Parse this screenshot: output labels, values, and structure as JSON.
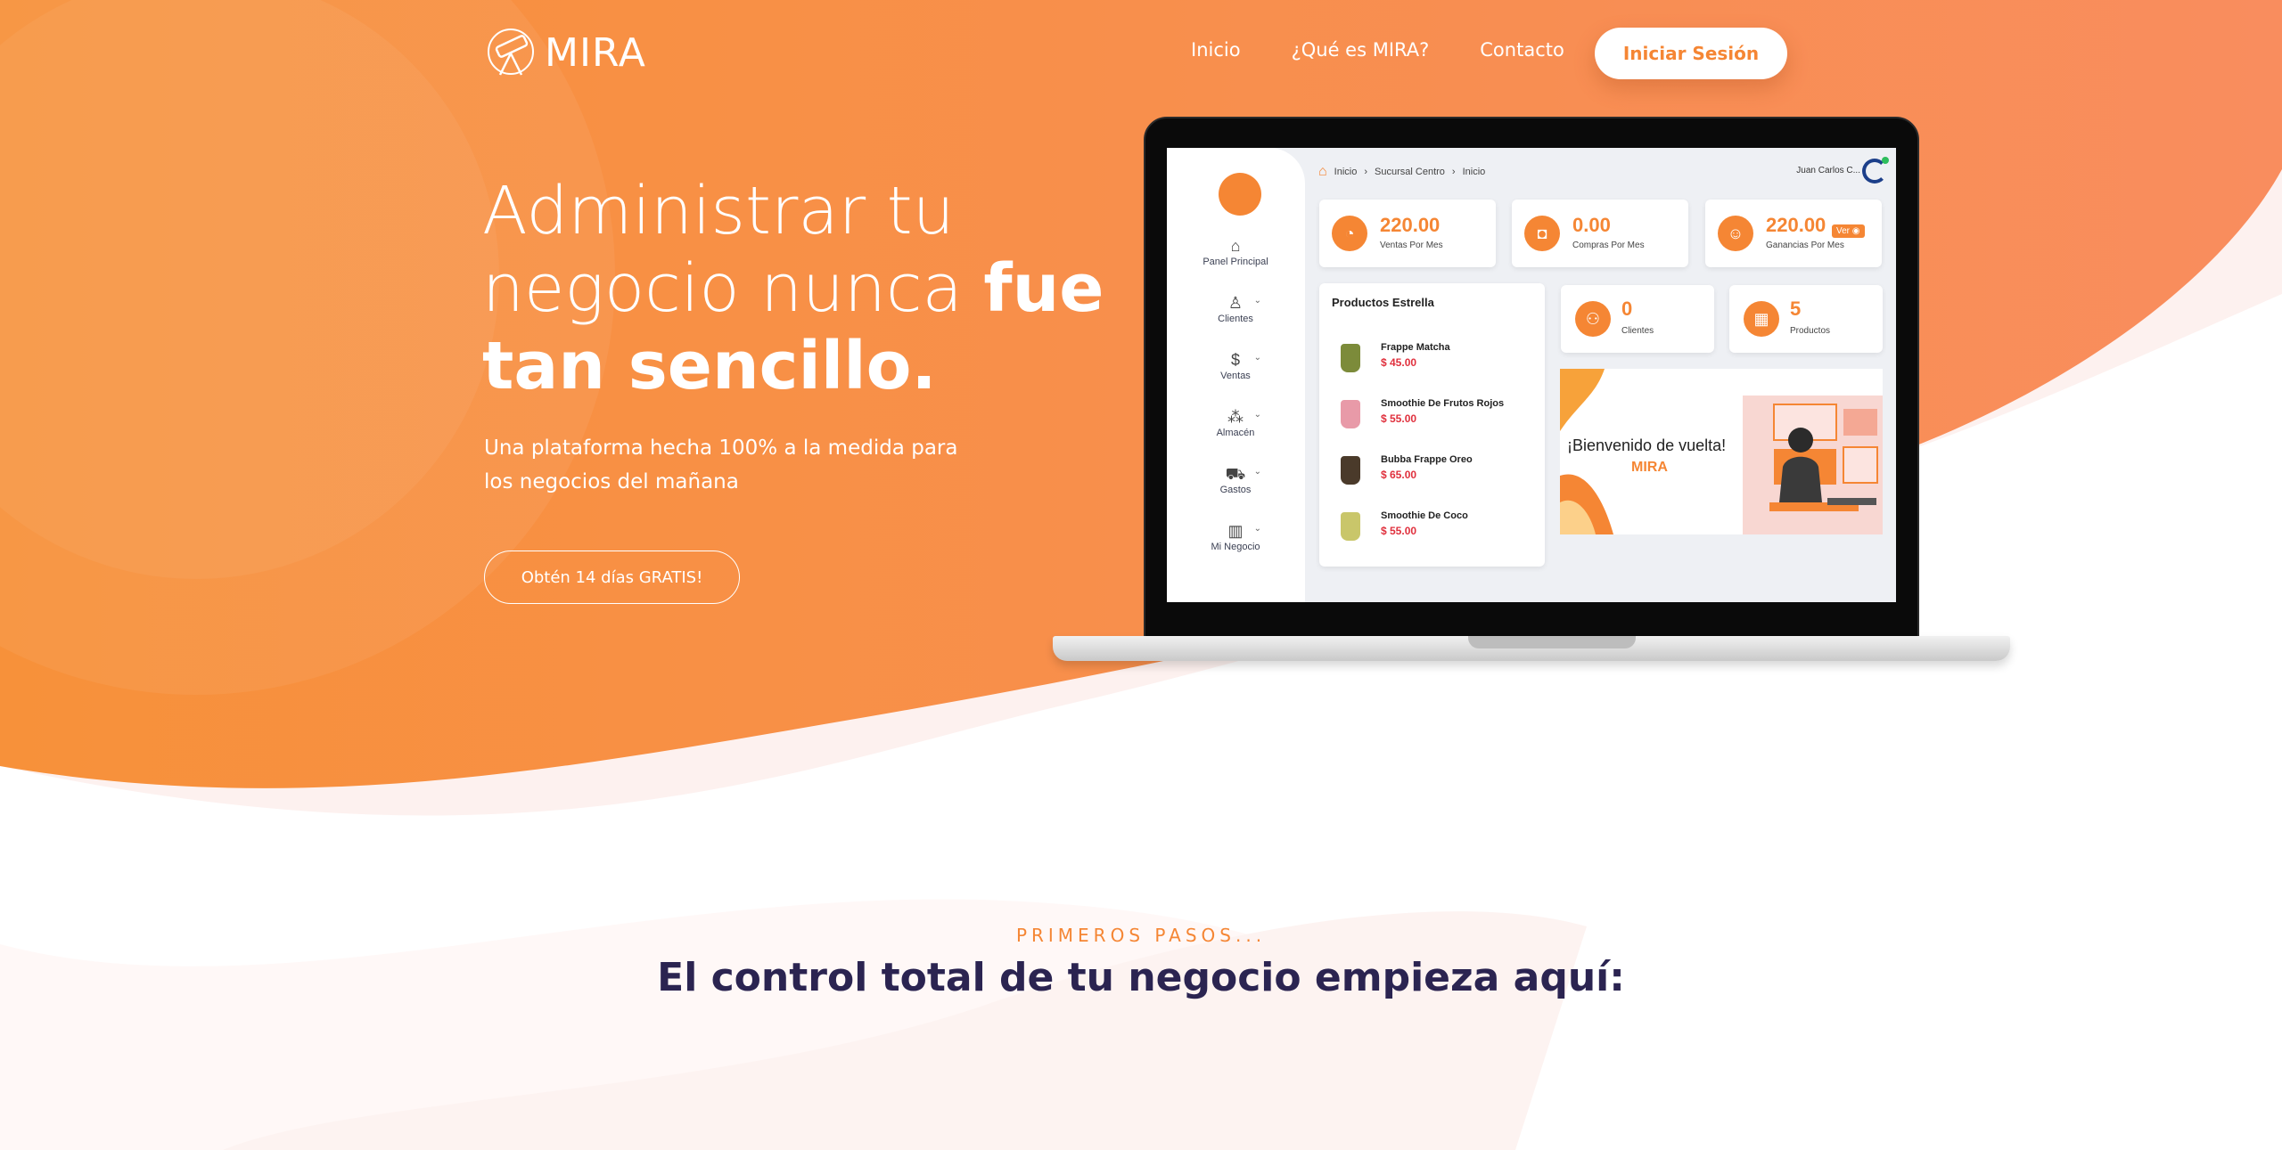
{
  "brand": {
    "name": "MIRA"
  },
  "nav": {
    "items": [
      "Inicio",
      "¿Qué es MIRA?",
      "Contacto"
    ],
    "login_label": "Iniciar Sesión"
  },
  "hero": {
    "title_light": "Administrar tu negocio nunca ",
    "title_bold": "fue tan sencillo.",
    "subtitle": "Una plataforma hecha 100% a la medida para los negocios del mañana",
    "cta_label": "Obtén 14 días GRATIS!"
  },
  "app": {
    "breadcrumb": [
      "Inicio",
      "Sucursal Centro",
      "Inicio"
    ],
    "user_name": "Juan Carlos C...",
    "sidebar": [
      {
        "label": "Panel Principal",
        "icon": "home-icon"
      },
      {
        "label": "Clientes",
        "icon": "user-add-icon"
      },
      {
        "label": "Ventas",
        "icon": "dollar-icon"
      },
      {
        "label": "Almacén",
        "icon": "boxes-icon"
      },
      {
        "label": "Gastos",
        "icon": "cart-icon"
      },
      {
        "label": "Mi Negocio",
        "icon": "chart-icon"
      }
    ],
    "stats": [
      {
        "value": "220.00",
        "label": "Ventas Por Mes"
      },
      {
        "value": "0.00",
        "label": "Compras Por Mes"
      },
      {
        "value": "220.00",
        "label": "Ganancias Por Mes"
      }
    ],
    "ver_label": "Ver",
    "counts": [
      {
        "value": "0",
        "label": "Clientes"
      },
      {
        "value": "5",
        "label": "Productos"
      }
    ],
    "products_title": "Productos Estrella",
    "products": [
      {
        "name": "Frappe Matcha",
        "price": "$ 45.00",
        "color": "#7c8b3a"
      },
      {
        "name": "Smoothie De Frutos Rojos",
        "price": "$ 55.00",
        "color": "#e89aa8"
      },
      {
        "name": "Bubba Frappe Oreo",
        "price": "$ 65.00",
        "color": "#4a3a2a"
      },
      {
        "name": "Smoothie De Coco",
        "price": "$ 55.00",
        "color": "#c9c66a"
      }
    ],
    "welcome": {
      "text": "¡Bienvenido de vuelta!",
      "brand": "MIRA"
    }
  },
  "section": {
    "kicker": "PRIMEROS PASOS...",
    "title": "El control total de tu negocio empieza aquí:"
  },
  "colors": {
    "accent": "#f58634",
    "heading": "#2b2451"
  }
}
